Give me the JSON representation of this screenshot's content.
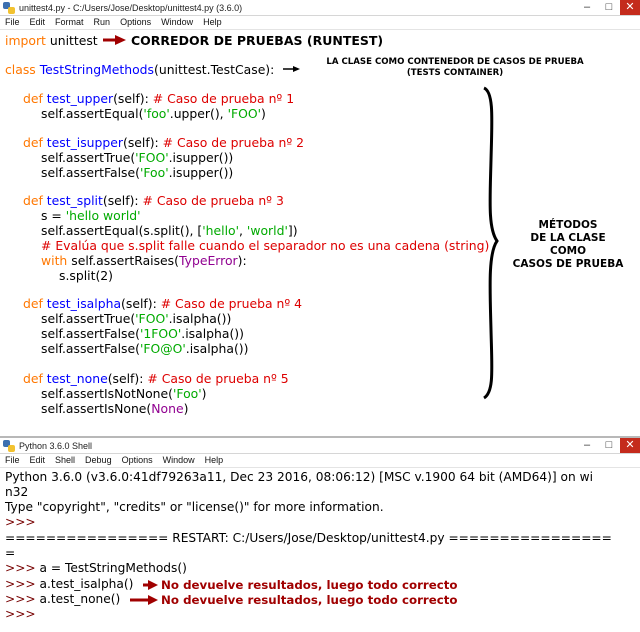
{
  "editor": {
    "title": "unittest4.py - C:/Users/Jose/Desktop/unittest4.py (3.6.0)",
    "menu": [
      "File",
      "Edit",
      "Format",
      "Run",
      "Options",
      "Window",
      "Help"
    ],
    "controls": {
      "minimize": "–",
      "maximize": "□",
      "close": "✕"
    }
  },
  "code": {
    "l1_kw": "import",
    "l1_rest": " unittest",
    "l2_kw": "class",
    "l2_name": " TestStringMethods",
    "l2_rest": "(unittest.TestCase):",
    "l3_kw": "def",
    "l3_name": " test_upper",
    "l3_rest": "(self): ",
    "l3_cm": "# Caso de prueba nº 1",
    "l4_a": "self.assertEqual(",
    "l4_s1": "'foo'",
    "l4_b": ".upper(), ",
    "l4_s2": "'FOO'",
    "l4_c": ")",
    "l5_kw": "def",
    "l5_name": " test_isupper",
    "l5_rest": "(self): ",
    "l5_cm": "# Caso de prueba nº 2",
    "l6_a": "self.assertTrue(",
    "l6_s": "'FOO'",
    "l6_b": ".isupper())",
    "l7_a": "self.assertFalse(",
    "l7_s": "'Foo'",
    "l7_b": ".isupper())",
    "l8_kw": "def",
    "l8_name": " test_split",
    "l8_rest": "(self): ",
    "l8_cm": "# Caso de prueba nº 3",
    "l9_a": "s = ",
    "l9_s": "'hello world'",
    "l10_a": "self.assertEqual(s.split(), [",
    "l10_s1": "'hello'",
    "l10_b": ", ",
    "l10_s2": "'world'",
    "l10_c": "])",
    "l11_cm": "# Evalúa que s.split falle cuando el separador no es una cadena (string)",
    "l12_kw": "with",
    "l12_a": " self.assertRaises(",
    "l12_bi": "TypeError",
    "l12_b": "):",
    "l13_a": "s.split(2)",
    "l14_kw": "def",
    "l14_name": " test_isalpha",
    "l14_rest": "(self): ",
    "l14_cm": "# Caso de prueba nº 4",
    "l15_a": "self.assertTrue(",
    "l15_s": "'FOO'",
    "l15_b": ".isalpha())",
    "l16_a": "self.assertFalse(",
    "l16_s": "'1FOO'",
    "l16_b": ".isalpha())",
    "l17_a": "self.assertFalse(",
    "l17_s": "'FO@O'",
    "l17_b": ".isalpha())",
    "l18_kw": "def",
    "l18_name": " test_none",
    "l18_rest": "(self): ",
    "l18_cm": "# Caso de prueba nº 5",
    "l19_a": "self.assertIsNotNone(",
    "l19_s": "'Foo'",
    "l19_b": ")",
    "l20_a": "self.assertIsNone(",
    "l20_bi": "None",
    "l20_b": ")"
  },
  "annotations": {
    "runner": "CORREDOR DE PRUEBAS (RUNTEST)",
    "container_1": "LA CLASE COMO CONTENEDOR DE CASOS DE PRUEBA",
    "container_2": "(TESTS CONTAINER)",
    "methods_1": "MÉTODOS",
    "methods_2": "DE LA CLASE",
    "methods_3": "COMO",
    "methods_4": "CASOS DE PRUEBA",
    "result_1": "No devuelve resultados, luego todo correcto",
    "result_2": "No devuelve resultados, luego todo correcto"
  },
  "shell": {
    "title": "Python 3.6.0 Shell",
    "menu": [
      "File",
      "Edit",
      "Shell",
      "Debug",
      "Options",
      "Window",
      "Help"
    ],
    "controls": {
      "minimize": "–",
      "maximize": "□",
      "close": "✕"
    },
    "s1": "Python 3.6.0 (v3.6.0:41df79263a11, Dec 23 2016, 08:06:12) [MSC v.1900 64 bit (AMD64)] on wi",
    "s2": "n32",
    "s3": "Type \"copyright\", \"credits\" or \"license()\" for more information.",
    "prompt": ">>> ",
    "s5": "================ RESTART: C:/Users/Jose/Desktop/unittest4.py ================",
    "s6": "=",
    "s7": "a = TestStringMethods()",
    "s8": "a.test_isalpha()",
    "s9": "a.test_none()"
  },
  "colors": {
    "keyword": "#ff7700",
    "defname": "#0000ff",
    "string": "#00aa00",
    "comment": "#dd0000",
    "builtin": "#900090",
    "arrow": "#a00000"
  }
}
